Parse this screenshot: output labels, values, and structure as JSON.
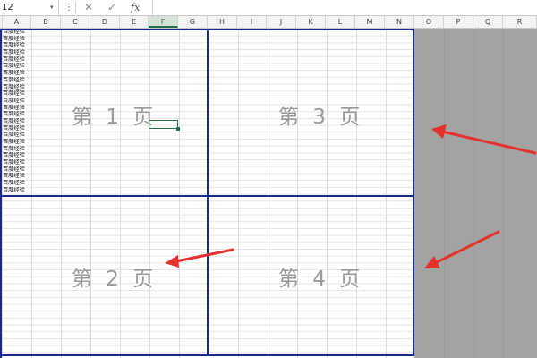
{
  "formula_bar": {
    "name_box_value": "12",
    "name_box_arrow": "▾",
    "dots": "⋮",
    "cancel_glyph": "✕",
    "enter_glyph": "✓",
    "fx_label": "fx",
    "formula_value": ""
  },
  "columns": [
    {
      "letter": "A",
      "active": false
    },
    {
      "letter": "B",
      "active": false
    },
    {
      "letter": "C",
      "active": false
    },
    {
      "letter": "D",
      "active": false
    },
    {
      "letter": "E",
      "active": false
    },
    {
      "letter": "F",
      "active": true
    },
    {
      "letter": "G",
      "active": false
    },
    {
      "letter": "H",
      "active": false
    },
    {
      "letter": "I",
      "active": false
    },
    {
      "letter": "J",
      "active": false
    },
    {
      "letter": "K",
      "active": false
    },
    {
      "letter": "L",
      "active": false
    },
    {
      "letter": "M",
      "active": false
    },
    {
      "letter": "N",
      "active": false
    },
    {
      "letter": "O",
      "active": false
    },
    {
      "letter": "P",
      "active": false
    },
    {
      "letter": "Q",
      "active": false
    },
    {
      "letter": "R",
      "active": false
    }
  ],
  "column_a_cells": [
    "百度经验",
    "百度经验",
    "百度经验",
    "百度经验",
    "百度经验",
    "百度经验",
    "百度经验",
    "百度经验",
    "百度经验",
    "百度经验",
    "百度经验",
    "百度经验",
    "百度经验",
    "百度经验",
    "百度经验",
    "百度经验",
    "百度经验",
    "百度经验",
    "百度经验",
    "百度经验",
    "百度经验",
    "百度经验",
    "百度经验",
    "百度经验"
  ],
  "pages": {
    "page1": "第 1 页",
    "page2": "第 2 页",
    "page3": "第 3 页",
    "page4": "第 4 页"
  },
  "colors": {
    "page_break": "#1a2a8a",
    "selection": "#217346",
    "arrow": "#e5312b",
    "outside_area": "#a3a3a3"
  }
}
